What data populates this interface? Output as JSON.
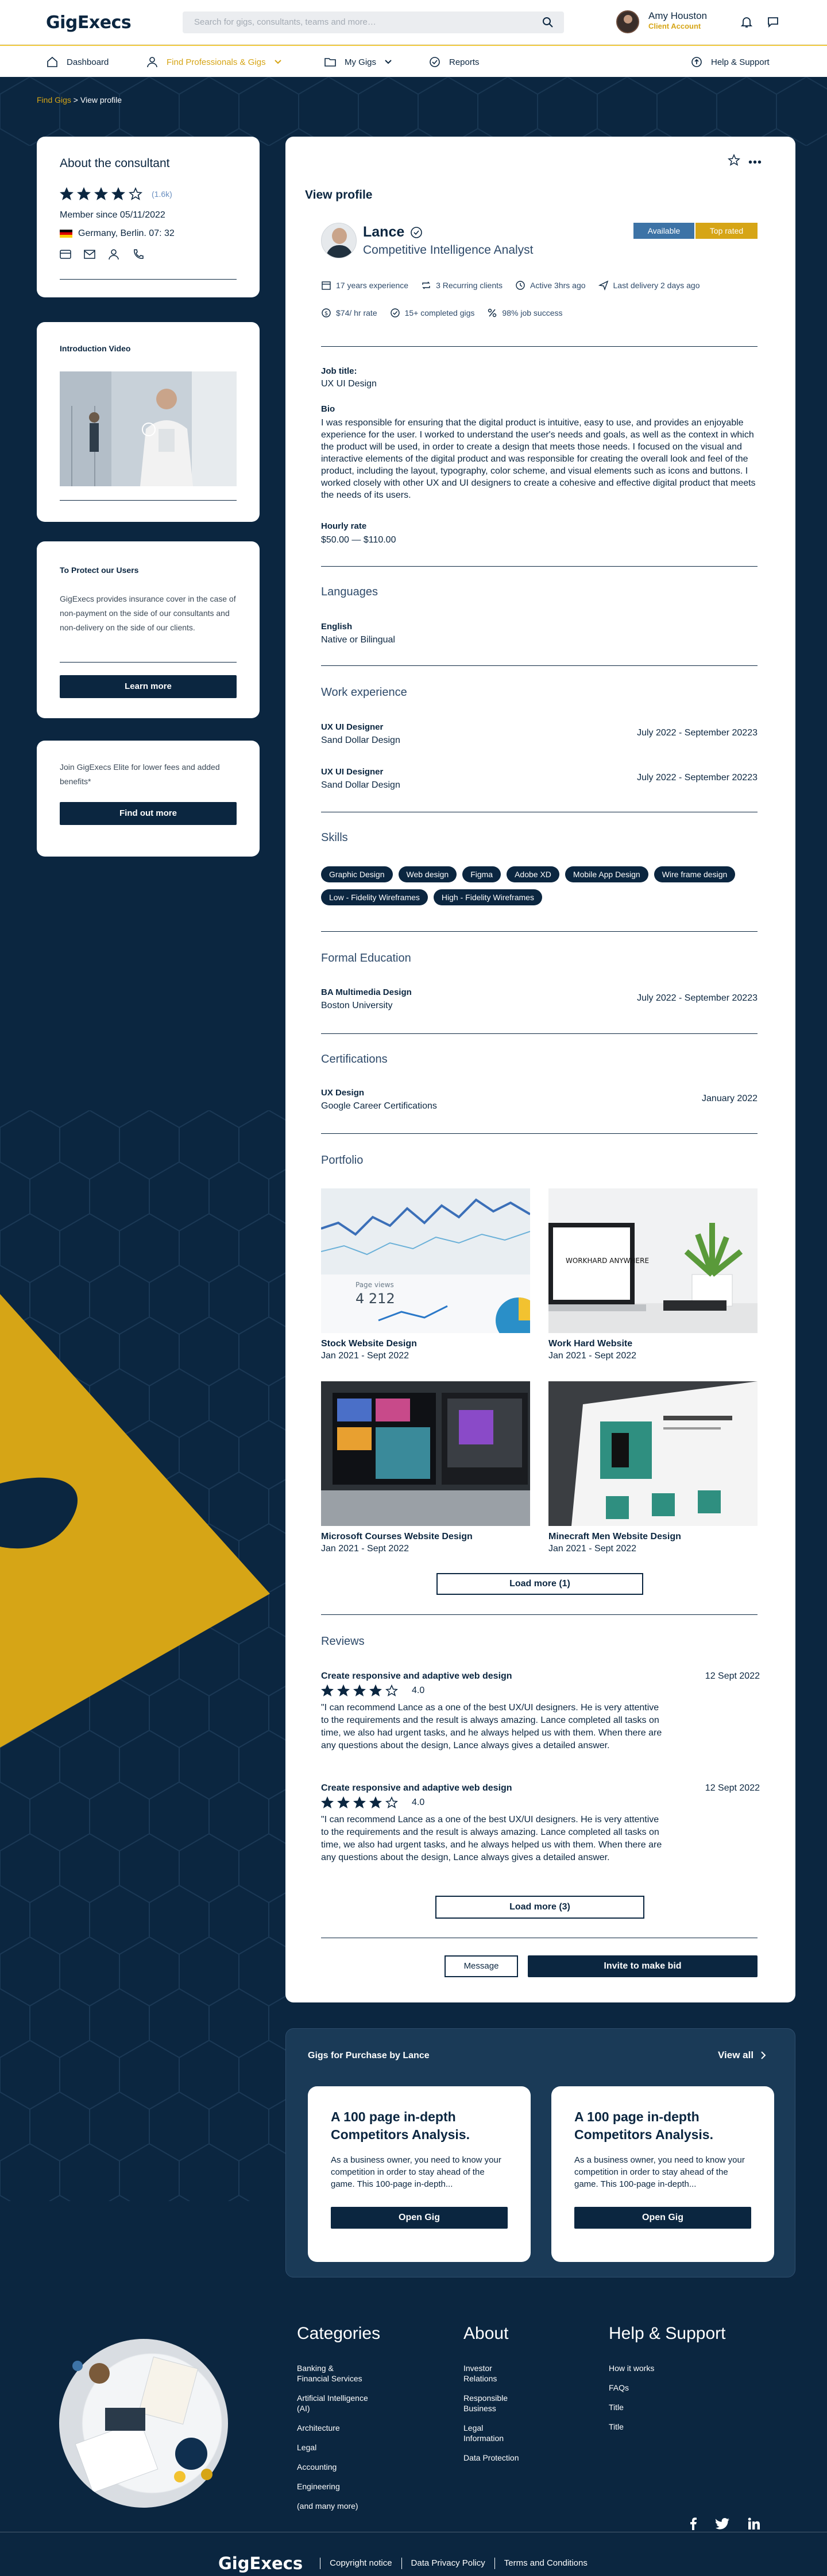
{
  "header": {
    "logo": "GigExecs",
    "search_placeholder": "Search for gigs, consultants, teams and more…",
    "user_name": "Amy Houston",
    "user_role": "Client Account"
  },
  "nav": {
    "dashboard": "Dashboard",
    "find": "Find Professionals & Gigs",
    "my_gigs": "My Gigs",
    "reports": "Reports",
    "help": "Help & Support"
  },
  "breadcrumb": {
    "parent": "Find Gigs",
    "separator": " > ",
    "current": "View profile"
  },
  "about": {
    "title": "About the consultant",
    "rating": 4,
    "rating_max": 5,
    "review_count": "(1.6k)",
    "member_since": "Member since 05/11/2022",
    "location": "Germany,  Berlin. 07: 32"
  },
  "video": {
    "title": "Introduction Video"
  },
  "protect": {
    "title": "To Protect our Users",
    "text": "GigExecs provides insurance cover in the case of non-payment on the side of our consultants and non-delivery on the side of our clients.",
    "button": "Learn more"
  },
  "elite": {
    "text": "Join GigExecs Elite for lower fees and added benefits*",
    "button": "Find out more"
  },
  "profile": {
    "page_title": "View profile",
    "name": "Lance",
    "role": "Competitive Intelligence Analyst",
    "badge_available": "Available",
    "badge_top": "Top rated",
    "stats1": {
      "experience": "17 years experience",
      "recurring": "3 Recurring clients",
      "active": "Active 3hrs ago",
      "last_delivery": "Last delivery 2 days ago"
    },
    "stats2": {
      "rate": "$74/ hr rate",
      "gigs": "15+ completed gigs",
      "success": "98% job success"
    },
    "job_title_label": "Job title:",
    "job_title": "UX UI Design",
    "bio_label": "Bio",
    "bio": "I was responsible for ensuring that the digital product is intuitive, easy to use, and provides an enjoyable experience for the user. I worked to understand the user's needs and goals, as well as the context in which the product will be used, in order to create a design that meets those needs. I focused on the visual and interactive elements of the digital product and was responsible for creating the overall look and feel of the product, including the layout, typography, color scheme, and visual elements such as icons and buttons. I worked closely with other UX and UI designers to create a cohesive and effective digital product that meets the needs of its users.",
    "hourly_label": "Hourly rate",
    "hourly": "$50.00 — $110.00",
    "languages_title": "Languages",
    "language": "English",
    "language_level": "Native or Bilingual",
    "work_title": "Work experience",
    "work": [
      {
        "role": "UX UI Designer",
        "company": "Sand Dollar Design",
        "dates": "July 2022 - September 20223"
      },
      {
        "role": "UX UI Designer",
        "company": "Sand Dollar Design",
        "dates": "July 2022 - September 20223"
      }
    ],
    "skills_title": "Skills",
    "skills": [
      "Graphic Design",
      "Web design",
      "Figma",
      "Adobe XD",
      "Mobile App Design",
      "Wire frame design",
      "Low - Fidelity Wireframes",
      "High - Fidelity Wireframes"
    ],
    "education_title": "Formal Education",
    "education": {
      "degree": "BA Multimedia Design",
      "school": "Boston University",
      "dates": "July 2022 - September 20223"
    },
    "cert_title": "Certifications",
    "cert": {
      "name": "UX Design",
      "issuer": "Google Career Certifications",
      "date": "January 2022"
    },
    "portfolio_title": "Portfolio",
    "portfolio": [
      {
        "title": "Stock Website Design",
        "dates": "Jan 2021 - Sept 2022"
      },
      {
        "title": "Work Hard Website",
        "dates": "Jan 2021 - Sept 2022"
      },
      {
        "title": "Microsoft Courses Website Design",
        "dates": "Jan 2021 - Sept 2022"
      },
      {
        "title": "Minecraft Men Website Design",
        "dates": "Jan 2021 - Sept 2022"
      }
    ],
    "portfolio_stat_text": "4 212",
    "portfolio_stat_label": "Page views",
    "portfolio_sign_text": "WORKHARD ANYWHERE",
    "portfolio_load_more": "Load more (1)",
    "reviews_title": "Reviews",
    "reviews": [
      {
        "title": "Create responsive and adaptive web design",
        "date": "12 Sept 2022",
        "rating": 4,
        "score": "4.0",
        "text": "\"I can recommend Lance as a one of the best UX/UI designers. He is very attentive to the requirements and the result is always amazing. Lance completed all tasks on time, we also had urgent tasks, and he always helped us with them. When there are any questions about the design, Lance always gives a detailed answer."
      },
      {
        "title": "Create responsive and adaptive web design",
        "date": "12 Sept 2022",
        "rating": 4,
        "score": "4.0",
        "text": "\"I can recommend Lance as a one of the best UX/UI designers. He is very attentive to the requirements and the result is always amazing. Lance completed all tasks on time, we also had urgent tasks, and he always helped us with them. When there are any questions about the design, Lance always gives a detailed answer."
      }
    ],
    "reviews_load_more": "Load more (3)",
    "message_button": "Message",
    "invite_button": "Invite to make bid"
  },
  "gigs": {
    "title": "Gigs for Purchase by Lance",
    "view_all": "View all",
    "items": [
      {
        "title": "A 100 page in-depth Competitors Analysis.",
        "text": "As a business owner, you need to know your competition in order to stay ahead of the game. This 100-page in-depth...",
        "button": "Open Gig"
      },
      {
        "title": "A 100 page in-depth Competitors Analysis.",
        "text": "As a business owner, you need to know your competition in order to stay ahead of the game. This 100-page in-depth...",
        "button": "Open Gig"
      }
    ]
  },
  "footer": {
    "categories_title": "Categories",
    "categories": [
      "Banking &\nFinancial Services",
      "Artificial Intelligence\n(AI)",
      "Architecture",
      "Legal",
      "Accounting",
      "Engineering",
      "(and many more)"
    ],
    "about_title": "About",
    "about": [
      "Investor\nRelations",
      "Responsible\nBusiness",
      "Legal\nInformation",
      "Data Protection"
    ],
    "help_title": "Help & Support",
    "help": [
      "How it works",
      "FAQs",
      "Title",
      "Title"
    ],
    "logo": "GigExecs",
    "links": [
      "Copyright notice",
      "Data Privacy Policy",
      "Terms and Conditions"
    ]
  },
  "colors": {
    "navy": "#0b2640",
    "gold": "#d6a516",
    "blue": "#3d73a6"
  }
}
